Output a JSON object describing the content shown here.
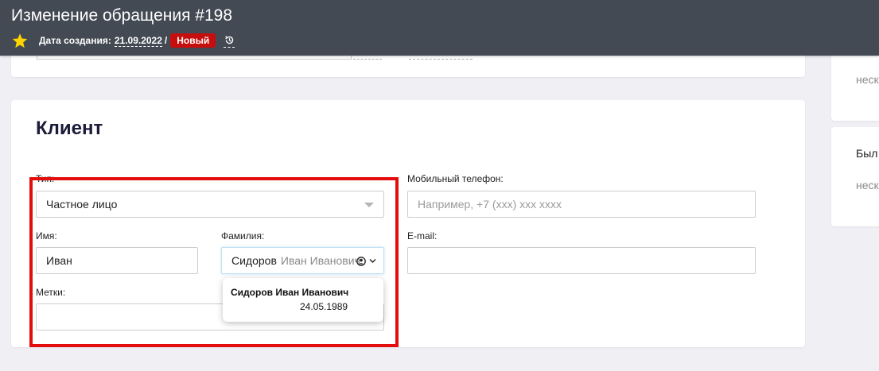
{
  "header": {
    "title": "Изменение обращения #198",
    "created_label": "Дата создания:",
    "created_date": "21.09.2022",
    "separator": "/",
    "status": "Новый"
  },
  "sidebar": {
    "card1_text": "неск",
    "card2_heading": "Был",
    "card2_text": "неск"
  },
  "client": {
    "title": "Клиент",
    "type_label": "Тип:",
    "type_value": "Частное лицо",
    "mobile_label": "Мобильный телефон:",
    "mobile_placeholder": "Например, +7 (xxx) xxx xxxx",
    "first_name_label": "Имя:",
    "first_name_value": "Иван",
    "last_name_label": "Фамилия:",
    "last_name_value": "Сидоров",
    "last_name_hint": "Иван Иванович",
    "email_label": "E-mail:",
    "email_value": "",
    "tags_label": "Метки:",
    "tags_value": ""
  },
  "suggestion": {
    "full_name": "Сидоров Иван Иванович",
    "birth_date": "24.05.1989"
  },
  "colors": {
    "header_bg": "#434a53",
    "status_badge": "#c70e0e",
    "highlight": "#e30d0d",
    "star": "#ffd400"
  }
}
